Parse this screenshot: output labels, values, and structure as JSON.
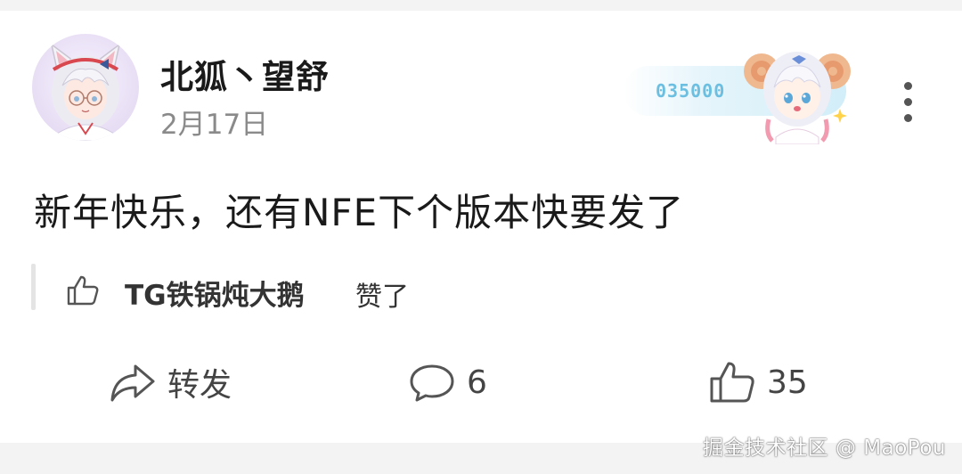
{
  "post": {
    "author": "北狐丶望舒",
    "date": "2月17日",
    "content": "新年快乐，还有NFE下个版本快要发了"
  },
  "badge": {
    "number": "035000"
  },
  "like_notice": {
    "user": "TG铁锅炖大鹅",
    "verb": "赞了"
  },
  "actions": {
    "forward_label": "转发",
    "comment_count": "6",
    "like_count": "35"
  },
  "watermark": "掘金技术社区 @ MaoPou",
  "icons": {
    "more": "more-vertical-icon",
    "like_notice": "thumbs-up-icon",
    "forward": "share-arrow-icon",
    "comment": "comment-bubble-icon",
    "like": "thumbs-up-icon"
  },
  "colors": {
    "badge_number": "#6cbfe0",
    "date": "#8a8a8a",
    "text": "#1a1a1a"
  }
}
